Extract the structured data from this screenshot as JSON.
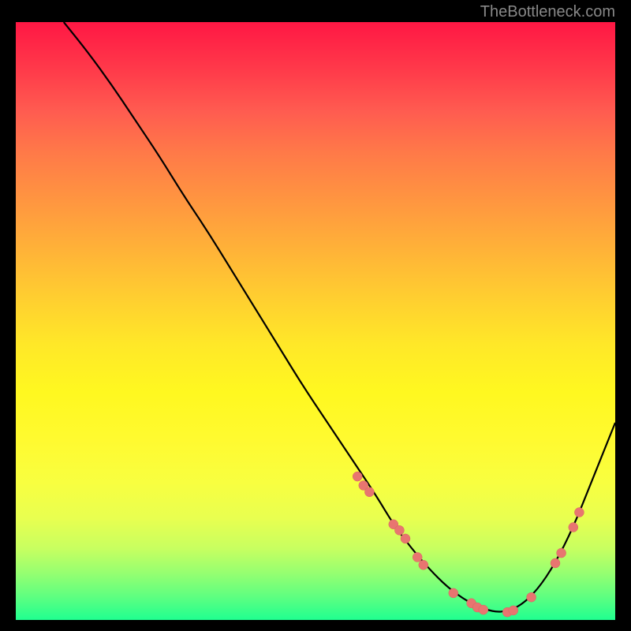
{
  "watermark": "TheBottleneck.com",
  "chart_data": {
    "type": "line",
    "title": "",
    "xlabel": "",
    "ylabel": "",
    "xlim": [
      0,
      100
    ],
    "ylim": [
      0,
      100
    ],
    "curve": {
      "x": [
        8,
        12,
        16,
        20,
        24,
        28,
        32,
        36,
        40,
        44,
        48,
        52,
        56,
        60,
        63,
        66,
        69,
        72,
        75,
        78,
        81,
        84,
        87,
        90,
        93,
        96,
        100
      ],
      "y": [
        100,
        95,
        89.5,
        83.5,
        77.5,
        71,
        65,
        58.5,
        52,
        45.5,
        39,
        33,
        27,
        21,
        16,
        12,
        8.5,
        5.5,
        3.3,
        1.8,
        1.2,
        2.2,
        5,
        9.5,
        15.5,
        23,
        33
      ]
    },
    "markers": {
      "x": [
        57,
        58,
        59,
        63,
        64,
        65,
        67,
        68,
        73,
        76,
        77,
        78,
        82,
        83,
        86,
        90,
        91,
        93,
        94
      ],
      "y": [
        24,
        22.5,
        21.4,
        16,
        15,
        13.6,
        10.5,
        9.2,
        4.5,
        2.8,
        2.1,
        1.7,
        1.3,
        1.6,
        3.8,
        9.5,
        11.2,
        15.5,
        18
      ]
    },
    "gradient": {
      "top": "#ff1744",
      "middle": "#ffe828",
      "bottom": "#20ff90"
    }
  }
}
